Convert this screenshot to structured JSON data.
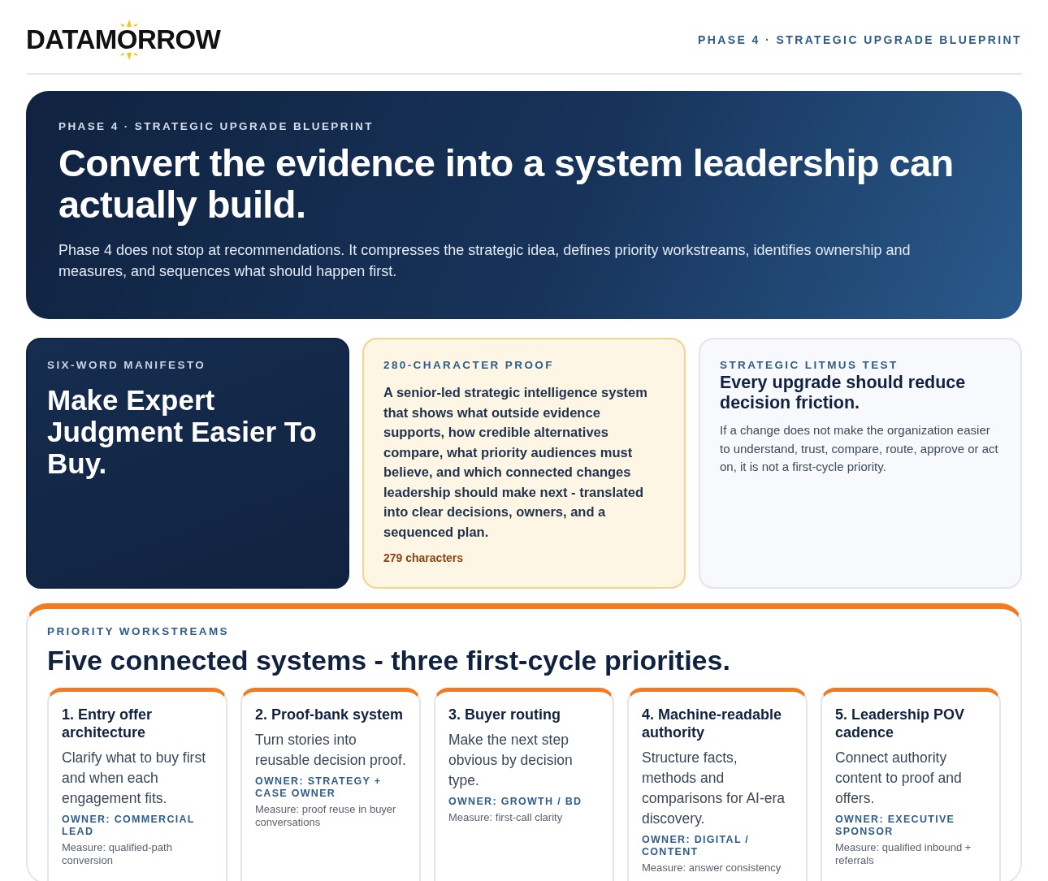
{
  "header": {
    "logo": "DATAMORROW",
    "tagline": "PHASE 4 · STRATEGIC UPGRADE BLUEPRINT"
  },
  "hero": {
    "eyebrow": "PHASE 4 · STRATEGIC UPGRADE BLUEPRINT",
    "title": "Convert the evidence into a system leadership can actually build.",
    "body": "Phase 4 does not stop at recommendations. It compresses the strategic idea, defines priority workstreams, identifies ownership and measures, and sequences what should happen first."
  },
  "manifesto": {
    "label": "SIX-WORD MANIFESTO",
    "text": "Make Expert Judgment Easier To Buy."
  },
  "proof": {
    "label": "280-CHARACTER PROOF",
    "text": "A senior-led strategic intelligence system that shows what outside evidence supports, how credible alternatives compare, what priority audiences must believe, and which connected changes leadership should make next - translated into clear decisions, owners, and a sequenced plan.",
    "count": "279 characters"
  },
  "litmus": {
    "label": "STRATEGIC LITMUS TEST",
    "title": "Every upgrade should reduce decision friction.",
    "body": "If a change does not make the organization easier to understand, trust, compare, route, approve or act on, it is not a first-cycle priority."
  },
  "workstreams": {
    "label": "PRIORITY WORKSTREAMS",
    "title": "Five connected systems - three first-cycle priorities.",
    "items": [
      {
        "title": "1. Entry offer architecture",
        "description": "Clarify what to buy first and when each engagement fits.",
        "owner": "OWNER: COMMERCIAL LEAD",
        "measure": "Measure: qualified-path conversion"
      },
      {
        "title": "2. Proof-bank system",
        "description": "Turn stories into reusable decision proof.",
        "owner": "OWNER: STRATEGY + CASE OWNER",
        "measure": "Measure: proof reuse in buyer conversations"
      },
      {
        "title": "3. Buyer routing",
        "description": "Make the next step obvious by decision type.",
        "owner": "OWNER: GROWTH / BD",
        "measure": "Measure: first-call clarity"
      },
      {
        "title": "4. Machine-readable authority",
        "description": "Structure facts, methods and comparisons for AI-era discovery.",
        "owner": "OWNER: DIGITAL / CONTENT",
        "measure": "Measure: answer consistency"
      },
      {
        "title": "5. Leadership POV cadence",
        "description": "Connect authority content to proof and offers.",
        "owner": "OWNER: EXECUTIVE SPONSOR",
        "measure": "Measure: qualified inbound + referrals"
      }
    ]
  }
}
